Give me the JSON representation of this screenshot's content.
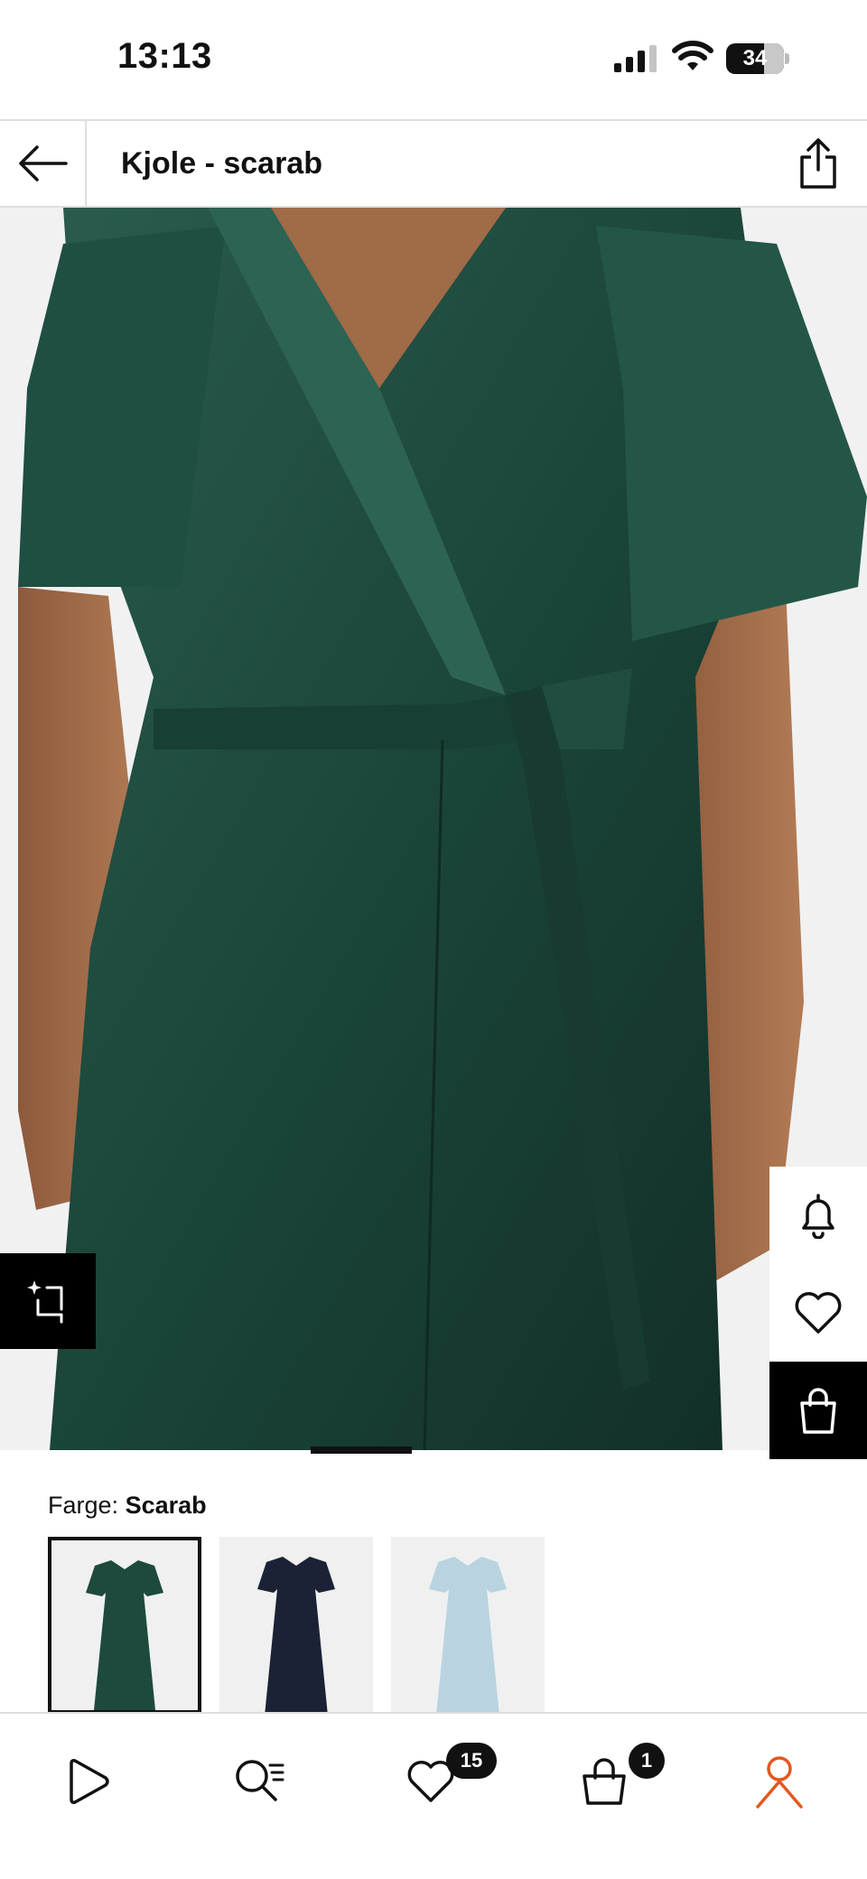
{
  "status_bar": {
    "time": "13:13",
    "battery": "34"
  },
  "header": {
    "title": "Kjole - scarab"
  },
  "product": {
    "color_label": "Farge:",
    "color_value": "Scarab",
    "swatches": [
      {
        "name": "scarab",
        "color": "#1d4a3d",
        "selected": true
      },
      {
        "name": "navy",
        "color": "#1b2235",
        "selected": false
      },
      {
        "name": "light-blue",
        "color": "#b9d4e0",
        "selected": false
      }
    ]
  },
  "bottom_nav": {
    "items": [
      {
        "icon": "play-icon"
      },
      {
        "icon": "search-list-icon"
      },
      {
        "icon": "heart-icon",
        "badge": "15"
      },
      {
        "icon": "bag-icon",
        "badge": "1"
      },
      {
        "icon": "profile-icon",
        "active": true
      }
    ]
  },
  "colors": {
    "accent": "#e2591f",
    "dress": "#1d4a3d",
    "background": "#f1f1f1"
  }
}
